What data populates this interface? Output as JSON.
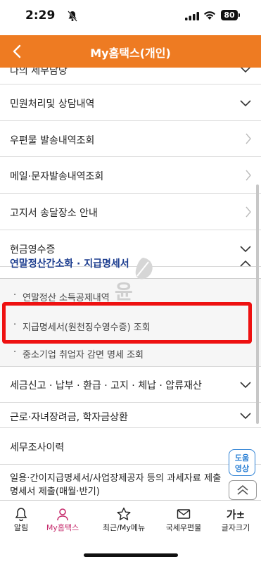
{
  "status_bar": {
    "time": "2:29",
    "battery": "80"
  },
  "header": {
    "title": "My홈택스(개인)"
  },
  "menu": {
    "items": [
      {
        "label": "나의 세무담당"
      },
      {
        "label": "민원처리및 상담내역"
      },
      {
        "label": "우편물 발송내역조회"
      },
      {
        "label": "메일·문자발송내역조회"
      },
      {
        "label": "고지서 송달장소 안내"
      },
      {
        "label": "현금영수증"
      },
      {
        "label": "연말정산간소화 · 지급명세서"
      },
      {
        "label": "세금신고 · 납부 · 환급 · 고지 · 체납 · 압류재산"
      },
      {
        "label": "근로·자녀장려금, 학자금상환"
      },
      {
        "label": "세무조사이력"
      },
      {
        "label": "일용·간이지급명세서/사업장제공자 등의 과세자료 제출"
      },
      {
        "label": "명세서 제출(매월·반기)"
      }
    ],
    "sub_items": [
      {
        "label": "연말정산 소득공제내역"
      },
      {
        "label": "지급명세서(원천징수영수증) 조회"
      },
      {
        "label": "중소기업 취업자 감면 명세 조회"
      }
    ],
    "bullet": "·"
  },
  "floating": {
    "help_line1": "도움",
    "help_line2": "영상"
  },
  "tabbar": {
    "tabs": [
      {
        "label": "알림",
        "icon": "bell-icon"
      },
      {
        "label": "My홈택스",
        "icon": "user-icon",
        "active": true
      },
      {
        "label": "최근/My메뉴",
        "icon": "star-icon"
      },
      {
        "label": "국세우편물",
        "icon": "mail-icon"
      },
      {
        "label": "글자크기",
        "icon": "font-size-icon",
        "glyph": "가±"
      }
    ]
  },
  "colors": {
    "header": "#ee7b22",
    "active_text": "#1c3d8f",
    "highlight": "#ee1111",
    "tab_active": "#c62b6c"
  }
}
